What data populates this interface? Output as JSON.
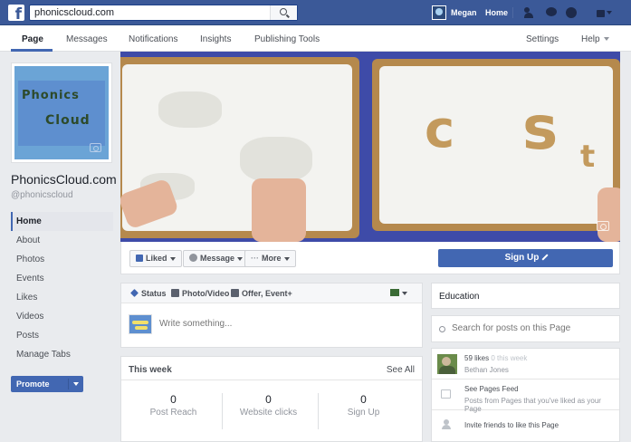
{
  "topbar": {
    "logo": "f",
    "search_value": "phonicscloud.com",
    "user_name": "Megan",
    "home_label": "Home"
  },
  "nav": {
    "tabs": [
      {
        "label": "Page"
      },
      {
        "label": "Messages"
      },
      {
        "label": "Notifications"
      },
      {
        "label": "Insights"
      },
      {
        "label": "Publishing Tools"
      }
    ],
    "settings_label": "Settings",
    "help_label": "Help"
  },
  "profile": {
    "logo_top": "Phonics",
    "logo_bottom": "Cloud",
    "page_name": "PhonicsCloud.com",
    "handle": "@phonicscloud"
  },
  "sidebar": {
    "items": [
      {
        "label": "Home"
      },
      {
        "label": "About"
      },
      {
        "label": "Photos"
      },
      {
        "label": "Events"
      },
      {
        "label": "Likes"
      },
      {
        "label": "Videos"
      },
      {
        "label": "Posts"
      },
      {
        "label": "Manage Tabs"
      }
    ],
    "promote_label": "Promote"
  },
  "cover": {
    "letters": [
      "c",
      "s",
      "t"
    ]
  },
  "actions": {
    "liked_label": "Liked",
    "message_label": "Message",
    "more_label": "More",
    "more_glyph": "···",
    "signup_label": "Sign Up"
  },
  "composer": {
    "status_label": "Status",
    "photo_label": "Photo/Video",
    "offer_label": "Offer, Event+",
    "placeholder": "Write something..."
  },
  "this_week": {
    "title": "This week",
    "see_all": "See All",
    "stats": [
      {
        "value": "0",
        "label": "Post Reach"
      },
      {
        "value": "0",
        "label": "Website clicks"
      },
      {
        "value": "0",
        "label": "Sign Up"
      }
    ]
  },
  "right": {
    "category": "Education",
    "search_placeholder": "Search for posts on this Page",
    "likes_count": "59 likes",
    "likes_week": "0 this week",
    "liker_name": "Bethan Jones",
    "pages_feed_title": "See Pages Feed",
    "pages_feed_desc": "Posts from Pages that you've liked as your Page",
    "invite_label": "Invite friends to like this Page"
  },
  "colors": {
    "brand": "#3b5998",
    "button_blue": "#4267b2",
    "cover_background": "#3e4ba8"
  }
}
